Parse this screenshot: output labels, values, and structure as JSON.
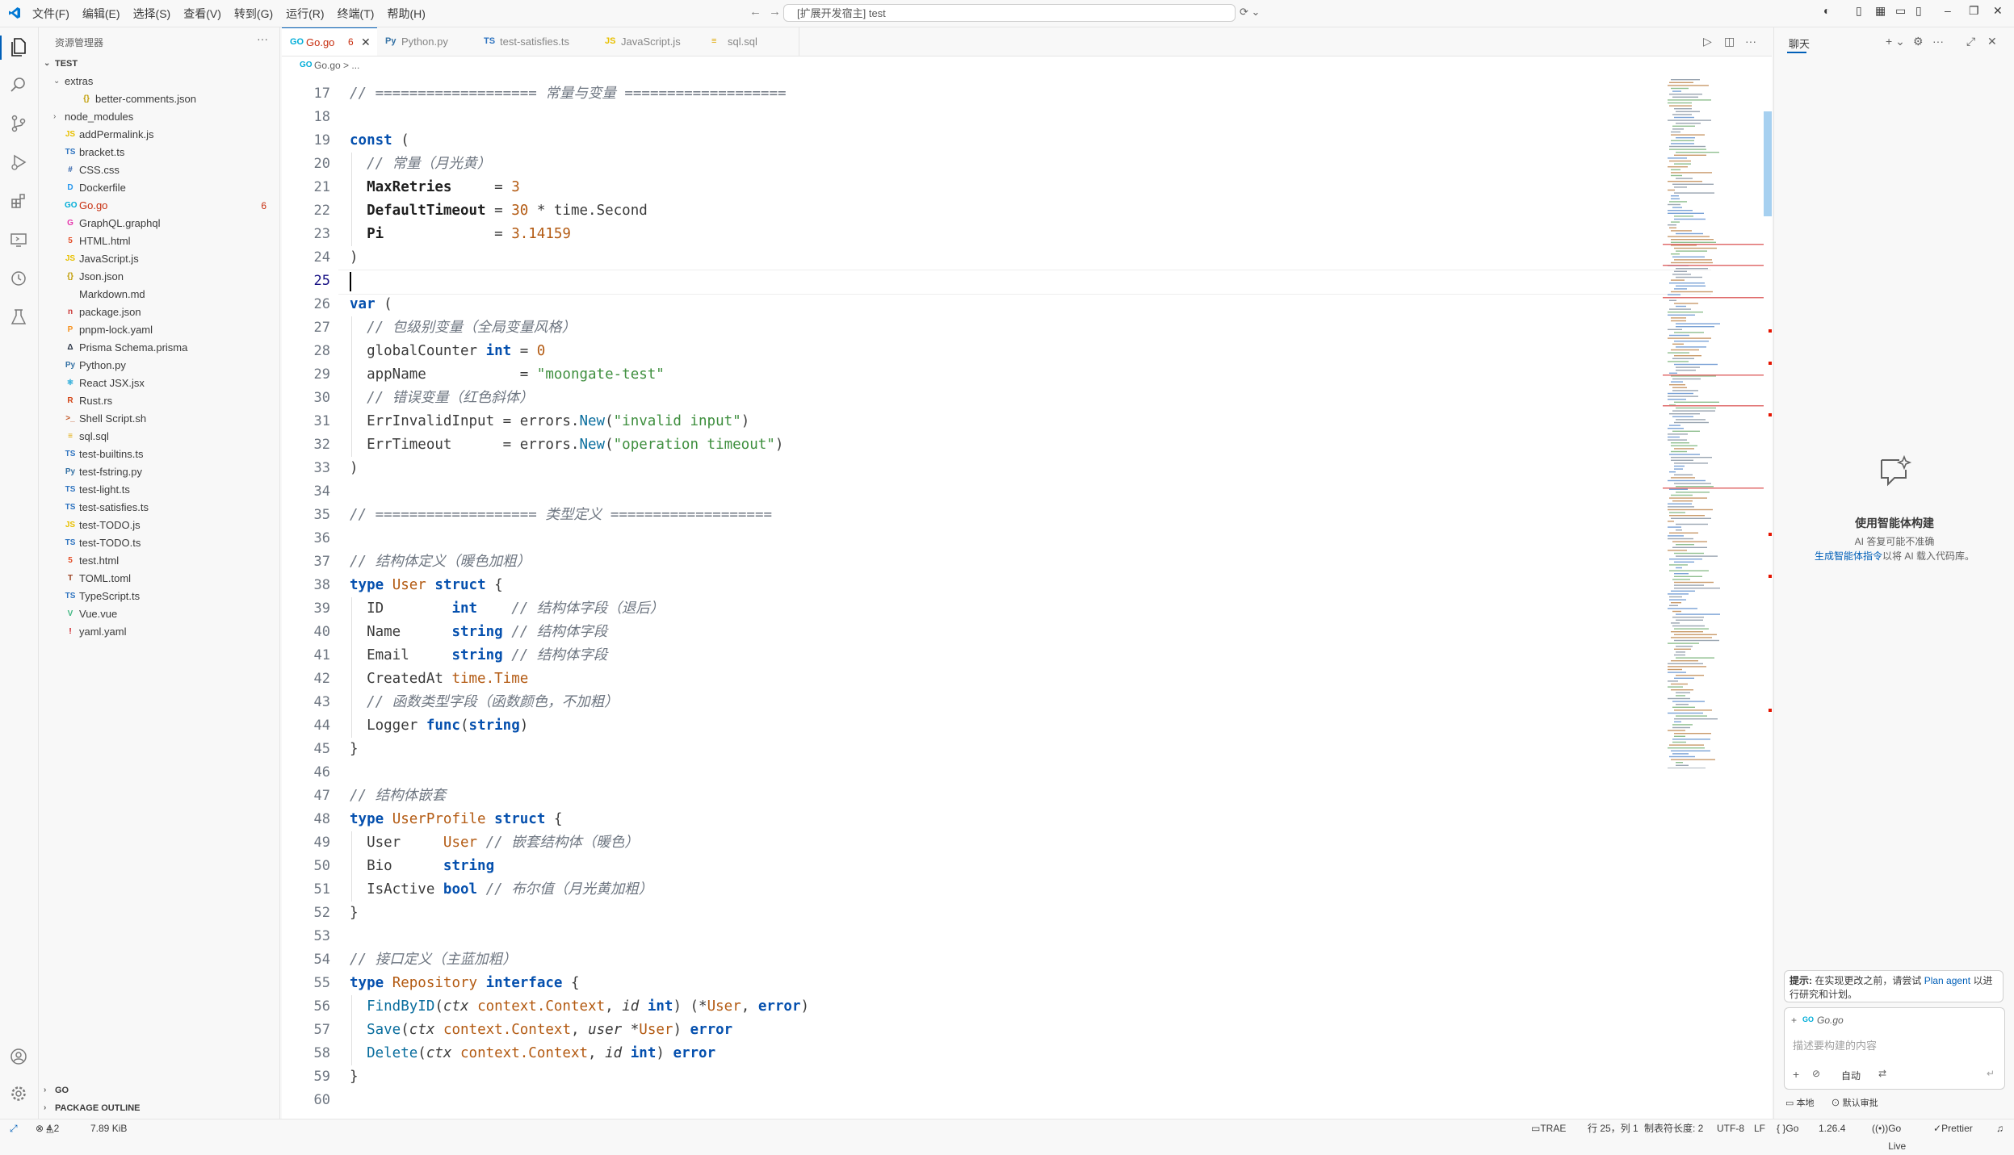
{
  "titlebar": {
    "menu": [
      "文件(F)",
      "编辑(E)",
      "选择(S)",
      "查看(V)",
      "转到(G)",
      "运行(R)",
      "终端(T)",
      "帮助(H)"
    ],
    "command_center": "[扩展开发宿主] test"
  },
  "sidebar": {
    "title": "资源管理器",
    "root": "TEST",
    "items": [
      {
        "label": "extras",
        "kind": "folder-open",
        "depth": 1,
        "icon": "chevron-down",
        "color": ""
      },
      {
        "label": "better-comments.json",
        "kind": "json",
        "depth": 2,
        "icon": "{}",
        "color": "#c09c00"
      },
      {
        "label": "node_modules",
        "kind": "folder",
        "depth": 1,
        "icon": "chevron-right",
        "color": ""
      },
      {
        "label": "addPermalink.js",
        "kind": "js",
        "depth": 1,
        "icon": "JS",
        "color": "#e8c000"
      },
      {
        "label": "bracket.ts",
        "kind": "ts",
        "depth": 1,
        "icon": "TS",
        "color": "#2f74c0"
      },
      {
        "label": "CSS.css",
        "kind": "css",
        "depth": 1,
        "icon": "#",
        "color": "#2b5ea8"
      },
      {
        "label": "Dockerfile",
        "kind": "docker",
        "depth": 1,
        "icon": "D",
        "color": "#2496ed"
      },
      {
        "label": "Go.go",
        "kind": "go",
        "depth": 1,
        "icon": "GO",
        "color": "#00add8",
        "badge": "6",
        "error": true
      },
      {
        "label": "GraphQL.graphql",
        "kind": "graphql",
        "depth": 1,
        "icon": "G",
        "color": "#e535ab"
      },
      {
        "label": "HTML.html",
        "kind": "html",
        "depth": 1,
        "icon": "5",
        "color": "#e44d26"
      },
      {
        "label": "JavaScript.js",
        "kind": "js",
        "depth": 1,
        "icon": "JS",
        "color": "#e8c000"
      },
      {
        "label": "Json.json",
        "kind": "json",
        "depth": 1,
        "icon": "{}",
        "color": "#c09c00"
      },
      {
        "label": "Markdown.md",
        "kind": "md",
        "depth": 1,
        "icon": "",
        "color": ""
      },
      {
        "label": "package.json",
        "kind": "npm",
        "depth": 1,
        "icon": "n",
        "color": "#cb3837"
      },
      {
        "label": "pnpm-lock.yaml",
        "kind": "pnpm",
        "depth": 1,
        "icon": "P",
        "color": "#f69220"
      },
      {
        "label": "Prisma Schema.prisma",
        "kind": "prisma",
        "depth": 1,
        "icon": "Δ",
        "color": "#2d3748"
      },
      {
        "label": "Python.py",
        "kind": "py",
        "depth": 1,
        "icon": "Py",
        "color": "#3572a5"
      },
      {
        "label": "React JSX.jsx",
        "kind": "jsx",
        "depth": 1,
        "icon": "⚛",
        "color": "#20a8d8"
      },
      {
        "label": "Rust.rs",
        "kind": "rs",
        "depth": 1,
        "icon": "R",
        "color": "#d34516"
      },
      {
        "label": "Shell Script.sh",
        "kind": "sh",
        "depth": 1,
        "icon": ">_",
        "color": "#c35a2b"
      },
      {
        "label": "sql.sql",
        "kind": "sql",
        "depth": 1,
        "icon": "≡",
        "color": "#e0a800"
      },
      {
        "label": "test-builtins.ts",
        "kind": "ts",
        "depth": 1,
        "icon": "TS",
        "color": "#2f74c0"
      },
      {
        "label": "test-fstring.py",
        "kind": "py",
        "depth": 1,
        "icon": "Py",
        "color": "#3572a5"
      },
      {
        "label": "test-light.ts",
        "kind": "ts",
        "depth": 1,
        "icon": "TS",
        "color": "#2f74c0"
      },
      {
        "label": "test-satisfies.ts",
        "kind": "ts",
        "depth": 1,
        "icon": "TS",
        "color": "#2f74c0"
      },
      {
        "label": "test-TODO.js",
        "kind": "js",
        "depth": 1,
        "icon": "JS",
        "color": "#e8c000"
      },
      {
        "label": "test-TODO.ts",
        "kind": "ts",
        "depth": 1,
        "icon": "TS",
        "color": "#2f74c0"
      },
      {
        "label": "test.html",
        "kind": "html",
        "depth": 1,
        "icon": "5",
        "color": "#e44d26"
      },
      {
        "label": "TOML.toml",
        "kind": "toml",
        "depth": 1,
        "icon": "T",
        "color": "#9c4221"
      },
      {
        "label": "TypeScript.ts",
        "kind": "ts",
        "depth": 1,
        "icon": "TS",
        "color": "#2f74c0"
      },
      {
        "label": "Vue.vue",
        "kind": "vue",
        "depth": 1,
        "icon": "V",
        "color": "#41b883"
      },
      {
        "label": "yaml.yaml",
        "kind": "yaml",
        "depth": 1,
        "icon": "!",
        "color": "#cb171e"
      }
    ],
    "sections": [
      "GO",
      "PACKAGE OUTLINE"
    ]
  },
  "tabs": [
    {
      "label": "Go.go",
      "icon": "GO",
      "color": "#00add8",
      "active": true,
      "badge": "6"
    },
    {
      "label": "Python.py",
      "icon": "Py",
      "color": "#3572a5",
      "active": false
    },
    {
      "label": "test-satisfies.ts",
      "icon": "TS",
      "color": "#2f74c0",
      "active": false
    },
    {
      "label": "JavaScript.js",
      "icon": "JS",
      "color": "#e8c000",
      "active": false
    },
    {
      "label": "sql.sql",
      "icon": "≡",
      "color": "#e0a800",
      "active": false
    }
  ],
  "breadcrumb": "Go.go > ...",
  "editor": {
    "current_line": 25,
    "lines": [
      {
        "n": 17,
        "segs": [
          [
            "cmt",
            "// =================== 常量与变量 ==================="
          ]
        ]
      },
      {
        "n": 18,
        "segs": []
      },
      {
        "n": 19,
        "segs": [
          [
            "kw",
            "const"
          ],
          [
            "",
            " ("
          ]
        ]
      },
      {
        "n": 20,
        "segs": [
          [
            "",
            "  "
          ],
          [
            "cmt",
            "// 常量（月光黄）"
          ]
        ]
      },
      {
        "n": 21,
        "segs": [
          [
            "",
            "  "
          ],
          [
            "cst",
            "MaxRetries"
          ],
          [
            "",
            "     = "
          ],
          [
            "num",
            "3"
          ]
        ]
      },
      {
        "n": 22,
        "segs": [
          [
            "",
            "  "
          ],
          [
            "cst",
            "DefaultTimeout"
          ],
          [
            "",
            " = "
          ],
          [
            "num",
            "30"
          ],
          [
            "",
            " * time.Second"
          ]
        ]
      },
      {
        "n": 23,
        "segs": [
          [
            "",
            "  "
          ],
          [
            "cst",
            "Pi"
          ],
          [
            "",
            "             = "
          ],
          [
            "num",
            "3.14159"
          ]
        ]
      },
      {
        "n": 24,
        "segs": [
          [
            "",
            ")"
          ]
        ]
      },
      {
        "n": 25,
        "segs": []
      },
      {
        "n": 26,
        "segs": [
          [
            "kw",
            "var"
          ],
          [
            "",
            " ("
          ]
        ]
      },
      {
        "n": 27,
        "segs": [
          [
            "",
            "  "
          ],
          [
            "cmt",
            "// 包级别变量（全局变量风格）"
          ]
        ]
      },
      {
        "n": 28,
        "segs": [
          [
            "",
            "  globalCounter "
          ],
          [
            "kw",
            "int"
          ],
          [
            "",
            " = "
          ],
          [
            "num",
            "0"
          ]
        ]
      },
      {
        "n": 29,
        "segs": [
          [
            "",
            "  appName           = "
          ],
          [
            "str",
            "\"moongate-test\""
          ]
        ]
      },
      {
        "n": 30,
        "segs": [
          [
            "",
            "  "
          ],
          [
            "cmt",
            "// 错误变量（红色斜体）"
          ]
        ]
      },
      {
        "n": 31,
        "segs": [
          [
            "",
            "  ErrInvalidInput = errors."
          ],
          [
            "fn",
            "New"
          ],
          [
            "",
            "("
          ],
          [
            "str",
            "\"invalid input\""
          ],
          [
            "",
            ")"
          ]
        ]
      },
      {
        "n": 32,
        "segs": [
          [
            "",
            "  ErrTimeout      = errors."
          ],
          [
            "fn",
            "New"
          ],
          [
            "",
            "("
          ],
          [
            "str",
            "\"operation timeout\""
          ],
          [
            "",
            ")"
          ]
        ]
      },
      {
        "n": 33,
        "segs": [
          [
            "",
            ")"
          ]
        ]
      },
      {
        "n": 34,
        "segs": []
      },
      {
        "n": 35,
        "segs": [
          [
            "cmt",
            "// =================== 类型定义 ==================="
          ]
        ]
      },
      {
        "n": 36,
        "segs": []
      },
      {
        "n": 37,
        "segs": [
          [
            "cmt",
            "// 结构体定义（暖色加粗）"
          ]
        ]
      },
      {
        "n": 38,
        "segs": [
          [
            "kw",
            "type"
          ],
          [
            "",
            " "
          ],
          [
            "typ",
            "User"
          ],
          [
            "",
            " "
          ],
          [
            "kw",
            "struct"
          ],
          [
            "",
            " {"
          ]
        ]
      },
      {
        "n": 39,
        "segs": [
          [
            "",
            "  ID        "
          ],
          [
            "kw",
            "int"
          ],
          [
            "",
            "    "
          ],
          [
            "cmt",
            "// 结构体字段（退后）"
          ]
        ]
      },
      {
        "n": 40,
        "segs": [
          [
            "",
            "  Name      "
          ],
          [
            "kw",
            "string"
          ],
          [
            "",
            " "
          ],
          [
            "cmt",
            "// 结构体字段"
          ]
        ]
      },
      {
        "n": 41,
        "segs": [
          [
            "",
            "  Email     "
          ],
          [
            "kw",
            "string"
          ],
          [
            "",
            " "
          ],
          [
            "cmt",
            "// 结构体字段"
          ]
        ]
      },
      {
        "n": 42,
        "segs": [
          [
            "",
            "  CreatedAt "
          ],
          [
            "typ",
            "time.Time"
          ]
        ]
      },
      {
        "n": 43,
        "segs": [
          [
            "",
            "  "
          ],
          [
            "cmt",
            "// 函数类型字段（函数颜色，不加粗）"
          ]
        ]
      },
      {
        "n": 44,
        "segs": [
          [
            "",
            "  Logger "
          ],
          [
            "kw",
            "func"
          ],
          [
            "",
            "("
          ],
          [
            "kw",
            "string"
          ],
          [
            "",
            ")"
          ]
        ]
      },
      {
        "n": 45,
        "segs": [
          [
            "",
            "}"
          ]
        ]
      },
      {
        "n": 46,
        "segs": []
      },
      {
        "n": 47,
        "segs": [
          [
            "cmt",
            "// 结构体嵌套"
          ]
        ]
      },
      {
        "n": 48,
        "segs": [
          [
            "kw",
            "type"
          ],
          [
            "",
            " "
          ],
          [
            "typ",
            "UserProfile"
          ],
          [
            "",
            " "
          ],
          [
            "kw",
            "struct"
          ],
          [
            "",
            " {"
          ]
        ]
      },
      {
        "n": 49,
        "segs": [
          [
            "",
            "  User     "
          ],
          [
            "typ",
            "User"
          ],
          [
            "",
            " "
          ],
          [
            "cmt",
            "// 嵌套结构体（暖色）"
          ]
        ]
      },
      {
        "n": 50,
        "segs": [
          [
            "",
            "  Bio      "
          ],
          [
            "kw",
            "string"
          ]
        ]
      },
      {
        "n": 51,
        "segs": [
          [
            "",
            "  IsActive "
          ],
          [
            "kw",
            "bool"
          ],
          [
            "",
            " "
          ],
          [
            "cmt",
            "// 布尔值（月光黄加粗）"
          ]
        ]
      },
      {
        "n": 52,
        "segs": [
          [
            "",
            "}"
          ]
        ]
      },
      {
        "n": 53,
        "segs": []
      },
      {
        "n": 54,
        "segs": [
          [
            "cmt",
            "// 接口定义（主蓝加粗）"
          ]
        ]
      },
      {
        "n": 55,
        "segs": [
          [
            "kw",
            "type"
          ],
          [
            "",
            " "
          ],
          [
            "typ",
            "Repository"
          ],
          [
            "",
            " "
          ],
          [
            "kw",
            "interface"
          ],
          [
            "",
            " {"
          ]
        ]
      },
      {
        "n": 56,
        "segs": [
          [
            "",
            "  "
          ],
          [
            "fn",
            "FindByID"
          ],
          [
            "",
            "("
          ],
          [
            "prm",
            "ctx"
          ],
          [
            "",
            " "
          ],
          [
            "typ",
            "context.Context"
          ],
          [
            "",
            ", "
          ],
          [
            "prm",
            "id"
          ],
          [
            "",
            " "
          ],
          [
            "kw",
            "int"
          ],
          [
            "",
            ") (*"
          ],
          [
            "typ",
            "User"
          ],
          [
            "",
            ", "
          ],
          [
            "kw",
            "error"
          ],
          [
            "",
            ")"
          ]
        ]
      },
      {
        "n": 57,
        "segs": [
          [
            "",
            "  "
          ],
          [
            "fn",
            "Save"
          ],
          [
            "",
            "("
          ],
          [
            "prm",
            "ctx"
          ],
          [
            "",
            " "
          ],
          [
            "typ",
            "context.Context"
          ],
          [
            "",
            ", "
          ],
          [
            "prm",
            "user"
          ],
          [
            "",
            " *"
          ],
          [
            "typ",
            "User"
          ],
          [
            "",
            ") "
          ],
          [
            "kw",
            "error"
          ]
        ]
      },
      {
        "n": 58,
        "segs": [
          [
            "",
            "  "
          ],
          [
            "fn",
            "Delete"
          ],
          [
            "",
            "("
          ],
          [
            "prm",
            "ctx"
          ],
          [
            "",
            " "
          ],
          [
            "typ",
            "context.Context"
          ],
          [
            "",
            ", "
          ],
          [
            "prm",
            "id"
          ],
          [
            "",
            " "
          ],
          [
            "kw",
            "int"
          ],
          [
            "",
            ") "
          ],
          [
            "kw",
            "error"
          ]
        ]
      },
      {
        "n": 59,
        "segs": [
          [
            "",
            "}"
          ]
        ]
      },
      {
        "n": 60,
        "segs": []
      }
    ]
  },
  "chat": {
    "title": "聊天",
    "heading": "使用智能体构建",
    "subtext": "AI 答复可能不准确",
    "link_text": "生成智能体指令",
    "link_suffix": "以将 AI 载入代码库。",
    "tip_prefix": "提示:",
    "tip_text": "在实现更改之前，请尝试",
    "tip_link": "Plan agent",
    "tip_suffix": "以进行研究和计划。",
    "context_file": "Go.go",
    "input_placeholder": "描述要构建的内容",
    "mode": "自动",
    "footer_left": "本地",
    "footer_right": "默认审批"
  },
  "statusbar": {
    "errors": "4",
    "warnings": "2",
    "size": "7.89 KiB",
    "trae": "TRAE",
    "position": "行 25，列 1",
    "tab_size": "制表符长度: 2",
    "encoding": "UTF-8",
    "eol": "LF",
    "language": "Go",
    "version": "1.26.4",
    "golive": "Go Live",
    "prettier": "Prettier"
  },
  "colors": {
    "accent": "#005fb8",
    "error": "#c72e0f",
    "link": "#005fb8"
  }
}
